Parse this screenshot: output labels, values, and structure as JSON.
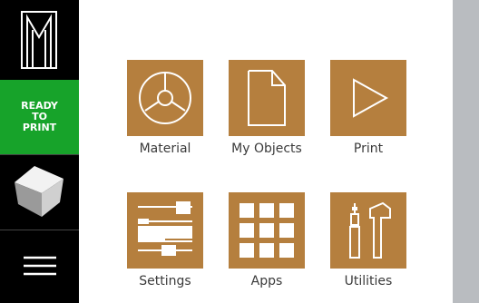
{
  "sidebar": {
    "logo_icon": "printer-brand-logo-icon",
    "status_label": "READY\nTO\nPRINT",
    "status_color": "#17a32a",
    "view_icon": "cube-3d-view-icon",
    "menu_icon": "hamburger-menu-icon"
  },
  "apps": {
    "accent_color": "#b57f3e",
    "items": [
      {
        "label": "Material",
        "icon": "spool-material-icon"
      },
      {
        "label": "My Objects",
        "icon": "document-icon"
      },
      {
        "label": "Print",
        "icon": "play-triangle-icon"
      },
      {
        "label": "Settings",
        "icon": "sliders-settings-icon"
      },
      {
        "label": "Apps",
        "icon": "grid-apps-icon"
      },
      {
        "label": "Utilities",
        "icon": "tools-icon"
      }
    ]
  }
}
